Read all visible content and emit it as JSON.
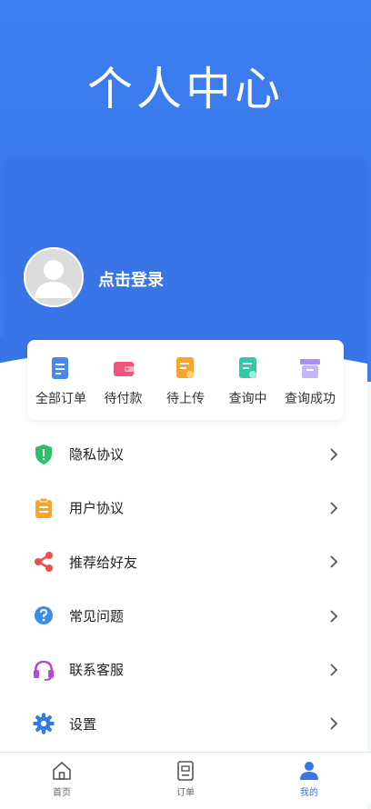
{
  "header": {
    "title": "个人中心"
  },
  "profile": {
    "login_text": "点击登录"
  },
  "orders": [
    {
      "label": "全部订单",
      "icon": "all-orders-icon",
      "color": "#4a88ee"
    },
    {
      "label": "待付款",
      "icon": "wallet-icon",
      "color": "#f0557a"
    },
    {
      "label": "待上传",
      "icon": "upload-doc-icon",
      "color": "#f6a531"
    },
    {
      "label": "查询中",
      "icon": "query-doc-icon",
      "color": "#35c8a6"
    },
    {
      "label": "查询成功",
      "icon": "success-box-icon",
      "color": "#a98ff2"
    }
  ],
  "menu": [
    {
      "label": "隐私协议",
      "icon": "shield-icon",
      "color": "#2fbf6a"
    },
    {
      "label": "用户协议",
      "icon": "clipboard-icon",
      "color": "#f6a531"
    },
    {
      "label": "推荐给好友",
      "icon": "share-icon",
      "color": "#ee4d4d"
    },
    {
      "label": "常见问题",
      "icon": "question-icon",
      "color": "#3a8ee8"
    },
    {
      "label": "联系客服",
      "icon": "headset-icon",
      "color": "#b34ad8"
    },
    {
      "label": "设置",
      "icon": "gear-icon",
      "color": "#2d7ce6"
    }
  ],
  "tabs": [
    {
      "label": "首页",
      "icon": "home-icon"
    },
    {
      "label": "订单",
      "icon": "order-icon"
    },
    {
      "label": "我的",
      "icon": "user-icon",
      "active": true
    }
  ],
  "colors": {
    "primary": "#3a75e8",
    "background": "#f3f6fc"
  }
}
